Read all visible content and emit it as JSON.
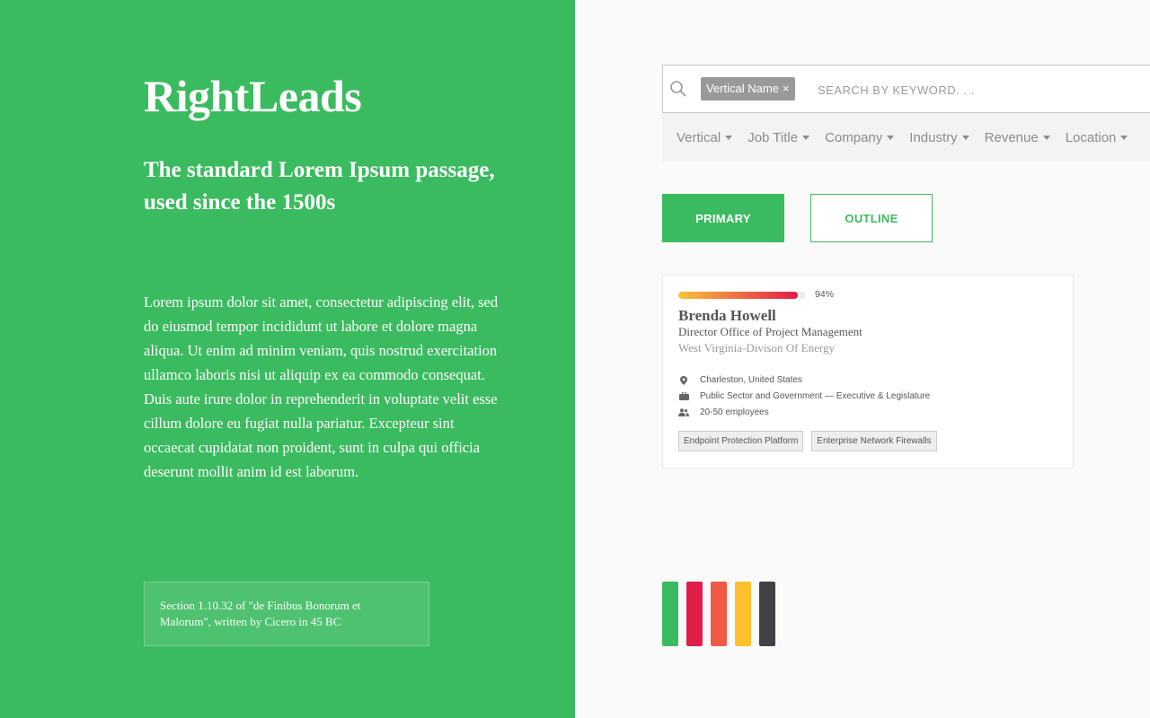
{
  "left": {
    "brand": "RightLeads",
    "tagline": "The standard Lorem Ipsum passage, used since the 1500s",
    "body": "Lorem ipsum dolor sit amet, consectetur adipiscing elit, sed do eiusmod tempor incididunt ut labore et dolore magna aliqua. Ut enim ad minim veniam, quis nostrud exercitation ullamco laboris nisi ut aliquip ex ea commodo consequat. Duis aute irure dolor in reprehenderit in voluptate velit esse cillum dolore eu fugiat nulla pariatur. Excepteur sint occaecat cupidatat non proident, sunt in culpa qui officia deserunt mollit anim id est laborum.",
    "note": "Section 1.10.32 of \"de Finibus Bonorum et Malorum\", written by Cicero in 45 BC"
  },
  "search": {
    "icon": "search-icon",
    "chip_label": "Vertical Name",
    "chip_remove": "×",
    "placeholder": "SEARCH BY KEYWORD. . ."
  },
  "filters": [
    {
      "label": "Vertical"
    },
    {
      "label": "Job Title"
    },
    {
      "label": "Company"
    },
    {
      "label": "Industry"
    },
    {
      "label": "Revenue"
    },
    {
      "label": "Location"
    }
  ],
  "buttons": {
    "primary": "PRIMARY",
    "outline": "OUTLINE"
  },
  "lead_card": {
    "score_label": "94%",
    "score_fraction": 0.94,
    "name": "Brenda Howell",
    "title": "Director Office of Project Management",
    "organization": "West Virginia-Divison Of Energy",
    "location": "Charleston, United States",
    "industry": "Public Sector and Government — Executive & Legislature",
    "employees": "20-50 employees",
    "tags": [
      "Endpoint Protection Platform",
      "Enterprise Network Firewalls"
    ]
  },
  "palette": [
    "#3bbb5f",
    "#e01e4a",
    "#f05a44",
    "#fcc12d",
    "#414146"
  ]
}
